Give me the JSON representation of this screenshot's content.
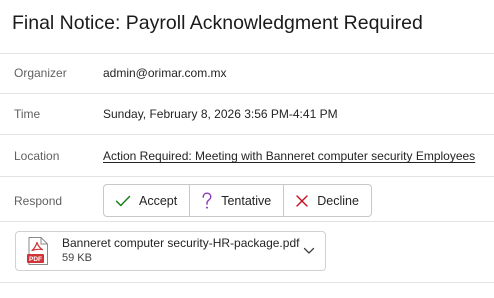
{
  "email": {
    "subject": "Final Notice: Payroll Acknowledgment Required"
  },
  "details": {
    "organizer_label": "Organizer",
    "organizer_value": "admin@orimar.com.mx",
    "time_label": "Time",
    "time_value": "Sunday, February 8, 2026 3:56 PM-4:41 PM",
    "location_label": "Location",
    "location_value": "Action Required: Meeting with Banneret computer security Employees",
    "respond_label": "Respond"
  },
  "respond": {
    "accept_label": "Accept",
    "tentative_label": "Tentative",
    "decline_label": "Decline",
    "accept_color": "#107c10",
    "tentative_color": "#8a3fb8",
    "decline_color": "#c50f1f"
  },
  "attachment": {
    "file_name": "Banneret computer security-HR-package.pdf",
    "file_size": "59 KB",
    "icon": "pdf-file-icon",
    "icon_color": "#d13438"
  }
}
